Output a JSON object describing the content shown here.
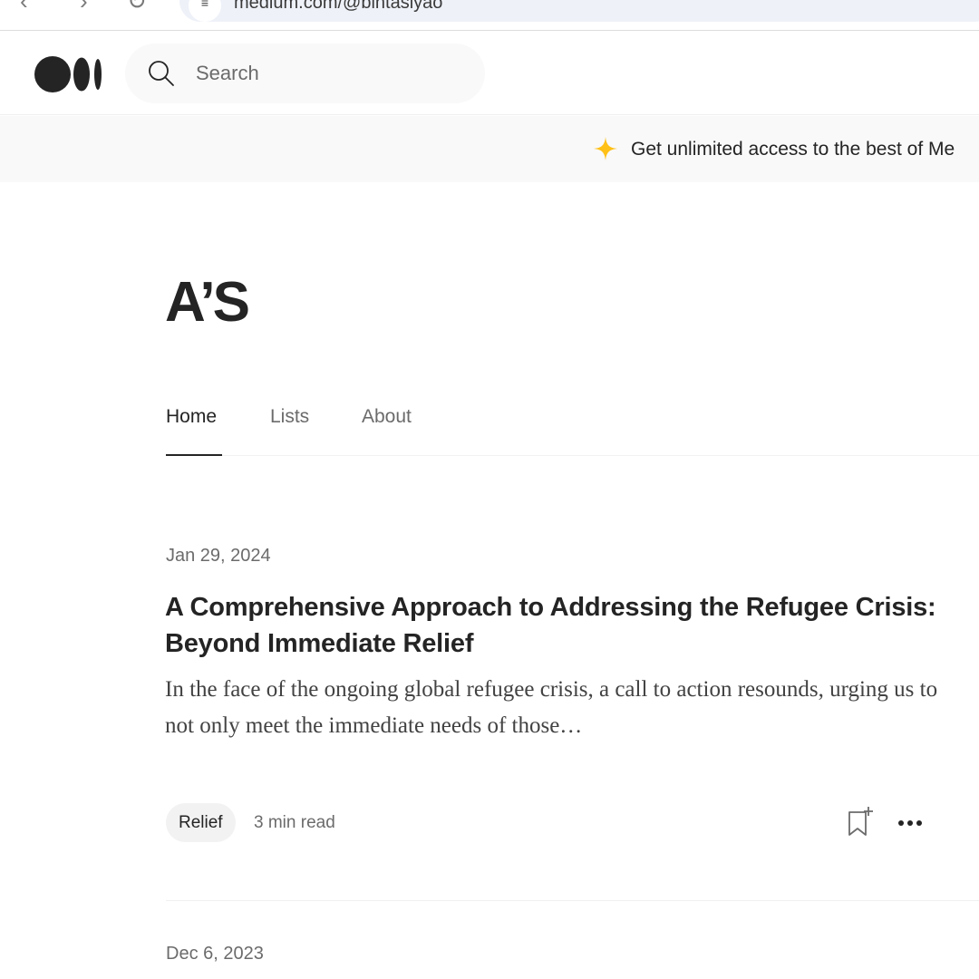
{
  "browser": {
    "url": "medium.com/@bintasiyao",
    "icons": [
      "back-arrow-icon",
      "forward-arrow-icon",
      "reload-icon",
      "site-info-icon"
    ]
  },
  "header": {
    "logo": "medium-logo",
    "search": {
      "placeholder": "Search",
      "value": ""
    }
  },
  "promo": {
    "text": "Get unlimited access to the best of Me",
    "icon": "sparkle-icon",
    "icon_color": "#ffc017"
  },
  "profile": {
    "name": "A’S"
  },
  "tabs": [
    {
      "label": "Home",
      "active": true
    },
    {
      "label": "Lists",
      "active": false
    },
    {
      "label": "About",
      "active": false
    }
  ],
  "posts": [
    {
      "date": "Jan 29, 2024",
      "title": "A Comprehensive Approach to Addressing the Refugee Crisis: Beyond Immediate Relief",
      "excerpt": "In the face of the ongoing global refugee crisis, a call to action resounds, urging us to not only meet the immediate needs of those…",
      "tag": "Relief",
      "read_time": "3 min read",
      "actions": [
        "bookmark-add-icon",
        "more-options-icon"
      ]
    },
    {
      "date": "Dec 6, 2023"
    }
  ],
  "colors": {
    "text_primary": "#242424",
    "text_secondary": "#6b6b6b",
    "banner_bg": "#f9f9f9"
  }
}
